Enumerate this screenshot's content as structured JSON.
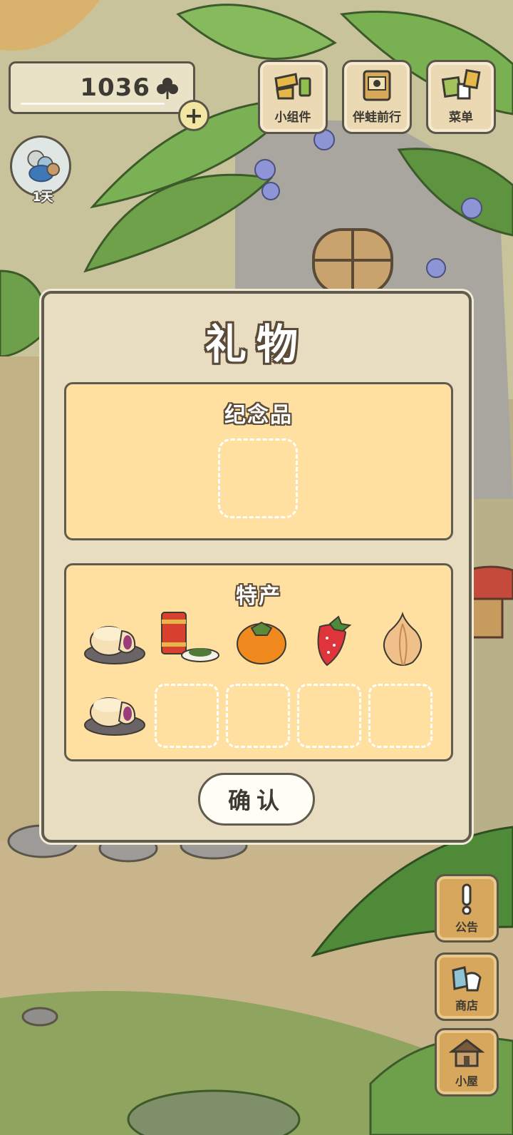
{
  "hud": {
    "clover_count": "1036",
    "add_symbol": "+",
    "days": "1天"
  },
  "top_menu": [
    {
      "label": "小组件",
      "icon": "widget-icon"
    },
    {
      "label": "伴蛙前行",
      "icon": "frog-album-icon"
    },
    {
      "label": "菜单",
      "icon": "menu-cards-icon"
    }
  ],
  "side_menu": [
    {
      "label": "公告",
      "icon": "exclamation-icon"
    },
    {
      "label": "商店",
      "icon": "shop-bag-icon"
    },
    {
      "label": "小屋",
      "icon": "house-icon"
    }
  ],
  "dialog": {
    "title": "礼物",
    "souvenir": {
      "title": "纪念品",
      "slots": 1
    },
    "specialty": {
      "title": "特产",
      "items": [
        {
          "icon": "pastry-icon"
        },
        {
          "icon": "tea-tin-icon"
        },
        {
          "icon": "persimmon-icon"
        },
        {
          "icon": "strawberry-icon"
        },
        {
          "icon": "onion-icon"
        },
        {
          "icon": "pastry-icon"
        }
      ],
      "empty_slots": 4
    },
    "confirm_label": "确认"
  },
  "colors": {
    "panel": "#e8ddc0",
    "section": "#ffe0a1",
    "outline": "#5f5b4f",
    "wood_button": "#d6a75c"
  }
}
